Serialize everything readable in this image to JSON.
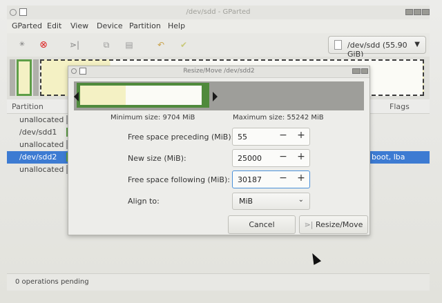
{
  "window": {
    "title": "/dev/sdd - GParted",
    "menu": [
      "GParted",
      "Edit",
      "View",
      "Device",
      "Partition",
      "Help"
    ],
    "device_selector": "/dev/sdd (55.90 GiB)"
  },
  "partition_list": {
    "columns": [
      "Partition",
      "Flags"
    ],
    "rows": [
      {
        "name": "unallocated",
        "flags": "",
        "color": "#a0a0a0"
      },
      {
        "name": "/dev/sdd1",
        "flags": "",
        "color": "#5e9e47"
      },
      {
        "name": "unallocated",
        "flags": "",
        "color": "#a0a0a0"
      },
      {
        "name": "/dev/sdd2",
        "flags": "boot, lba",
        "color": "#5e9e47",
        "selected": true
      },
      {
        "name": "unallocated",
        "flags": "",
        "color": "#a0a0a0"
      }
    ]
  },
  "status": {
    "text": "0 operations pending"
  },
  "dialog": {
    "title": "Resize/Move /dev/sdd2",
    "min_size": "Minimum size: 9704 MiB",
    "max_size": "Maximum size: 55242 MiB",
    "fields": {
      "preceding": {
        "label": "Free space preceding (MiB):",
        "value": "55"
      },
      "new_size": {
        "label": "New size (MiB):",
        "value": "25000"
      },
      "following": {
        "label": "Free space following (MiB):",
        "value": "30187"
      }
    },
    "align": {
      "label": "Align to:",
      "value": "MiB"
    },
    "cancel_label": "Cancel",
    "resize_label": "Resize/Move"
  },
  "colors": {
    "partition_border": "#4f8a3c",
    "used_space": "#f4f1c4",
    "unallocated": "#9e9e9a",
    "selection": "#3d7bd2"
  }
}
